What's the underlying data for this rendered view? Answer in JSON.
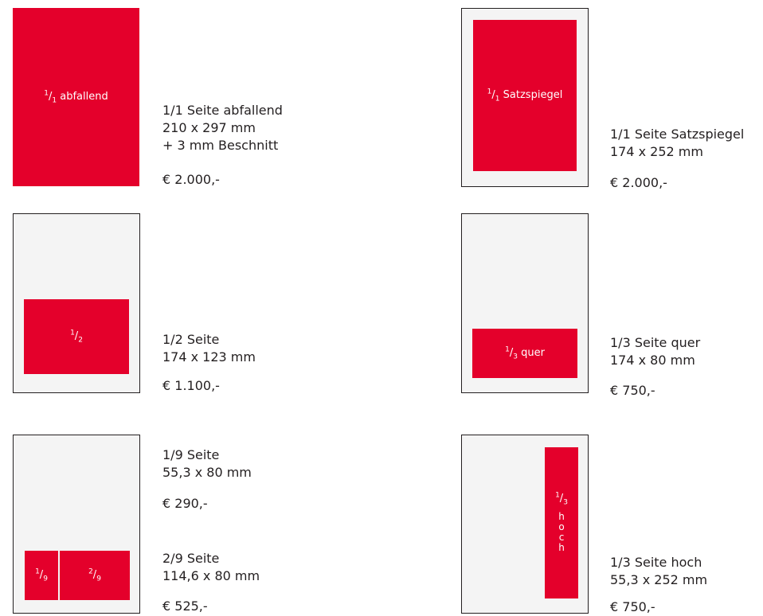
{
  "colors": {
    "ad": "#e4002b",
    "page": "#f4f4f4",
    "border": "#231f20",
    "text": "#231f20"
  },
  "items": {
    "full_bleed": {
      "label_num": "1",
      "label_den": "1",
      "label_text": "abfallend",
      "lines": [
        "1/1 Seite abfallend",
        "210 x 297 mm",
        "+ 3 mm Beschnitt"
      ],
      "price": "€ 2.000,-"
    },
    "full_type": {
      "label_num": "1",
      "label_den": "1",
      "label_text": "Satzspiegel",
      "lines": [
        "1/1 Seite Satzspiegel",
        "174 x 252 mm"
      ],
      "price": "€ 2.000,-"
    },
    "half": {
      "label_num": "1",
      "label_den": "2",
      "lines": [
        "1/2 Seite",
        "174 x 123 mm"
      ],
      "price": "€ 1.100,-"
    },
    "third_landscape": {
      "label_num": "1",
      "label_den": "3",
      "label_text": "quer",
      "lines": [
        "1/3 Seite quer",
        "174 x 80 mm"
      ],
      "price": "€ 750,-"
    },
    "ninth": {
      "label_num": "1",
      "label_den": "9",
      "lines": [
        "1/9 Seite",
        "55,3 x 80 mm"
      ],
      "price": "€ 290,-"
    },
    "two_ninths": {
      "label_num": "2",
      "label_den": "9",
      "lines": [
        "2/9 Seite",
        "114,6 x 80 mm"
      ],
      "price": "€ 525,-"
    },
    "third_portrait": {
      "label_num": "1",
      "label_den": "3",
      "label_letters": [
        "h",
        "o",
        "c",
        "h"
      ],
      "lines": [
        "1/3 Seite hoch",
        "55,3 x 252 mm"
      ],
      "price": "€ 750,-"
    }
  }
}
